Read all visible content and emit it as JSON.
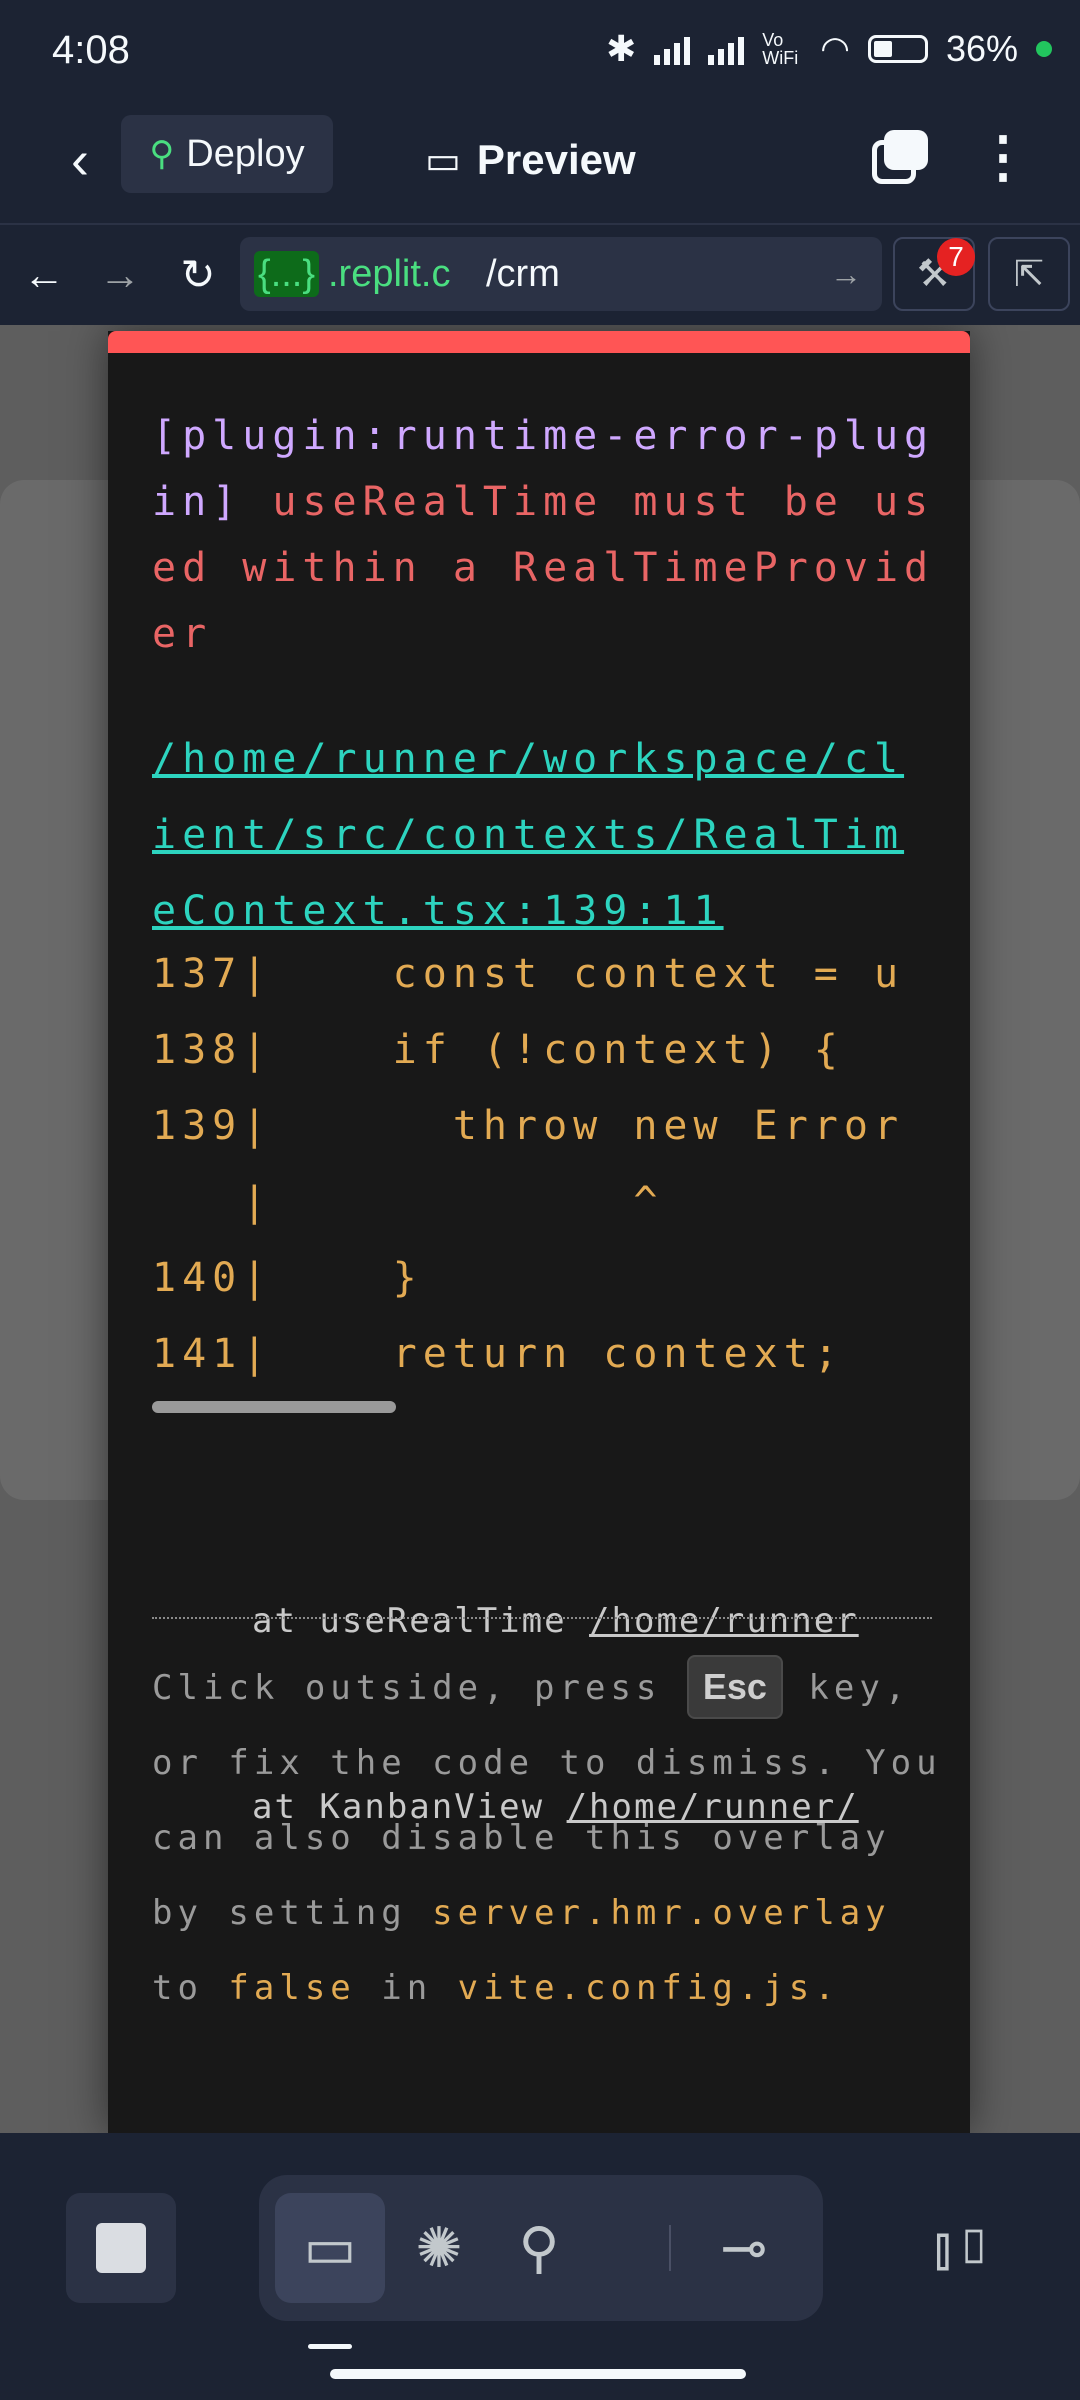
{
  "status_bar": {
    "time": "4:08",
    "volte": "Vo WiFi",
    "battery": "36%",
    "icons": [
      "bluetooth-icon",
      "signal-icon",
      "signal-icon",
      "vowifi-icon",
      "wifi-icon",
      "battery-icon",
      "dot-icon"
    ]
  },
  "header": {
    "back_icon": "chevron-left-icon",
    "deploy_label": "Deploy",
    "preview_label": "Preview",
    "tabs_icon": "tabs-icon",
    "more_icon": "more-vertical-icon"
  },
  "urlbar": {
    "back_icon": "arrow-left-icon",
    "forward_icon": "arrow-right-icon",
    "reload_icon": "reload-icon",
    "url_badge": "{...}",
    "url_host": ".replit.c",
    "url_path": "/crm",
    "devtools_badge": "7"
  },
  "error_overlay": {
    "plugin": "[plugin:runtime-error-plugin]",
    "message": " useRealTime must be used within a RealTimeProvider",
    "file": "/home/runner/workspace/client/src/contexts/RealTimeContext.tsx:139:11",
    "frame_lines": [
      "137|    const context = u",
      "138|    if (!context) {",
      "139|      throw new Error",
      "   |            ^",
      "140|    }",
      "141|    return context;"
    ],
    "stack": [
      {
        "prefix": "at useRealTime ",
        "link": "/home/runner"
      },
      {
        "prefix": "at KanbanView ",
        "link": "/home/runner/"
      }
    ],
    "tip_1": "Click outside, press ",
    "esc_key": "Esc",
    "tip_2": " key, or fix the code to dismiss. You can also disable this overlay by setting ",
    "tip_code_1": "server.hmr.overlay",
    "tip_3": " to ",
    "tip_code_2": "false",
    "tip_4": " in ",
    "tip_code_3": "vite.config.js",
    "tip_5": "."
  },
  "bottom_toolbar": {
    "stop_icon": "stop-icon",
    "modes": [
      "monitor-icon",
      "workflows-icon",
      "deploy-antenna-icon",
      "git-branch-icon"
    ],
    "panel_icon": "panel-toggle-icon"
  }
}
